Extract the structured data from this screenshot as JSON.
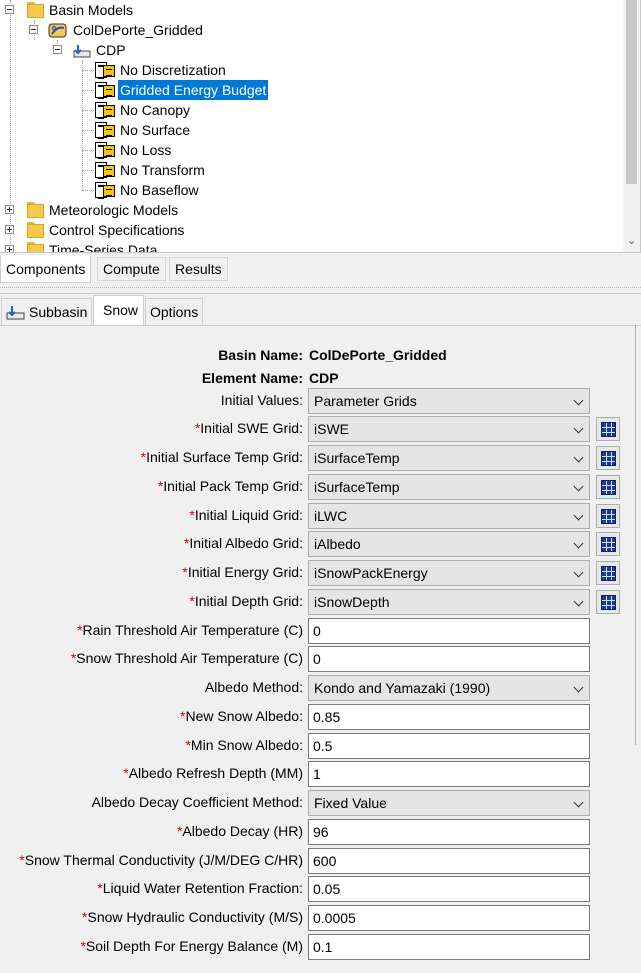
{
  "tree": {
    "basin_models": "Basin Models",
    "basin": "ColDePorte_Gridded",
    "cdp": "CDP",
    "methods": [
      "No Discretization",
      "Gridded Energy Budget",
      "No Canopy",
      "No Surface",
      "No Loss",
      "No Transform",
      "No Baseflow"
    ],
    "selected_method": "Gridded Energy Budget",
    "meteorologic_models": "Meteorologic Models",
    "control_specifications": "Control Specifications",
    "time_series_data": "Time-Series Data"
  },
  "bottom_tabs": [
    "Components",
    "Compute",
    "Results"
  ],
  "editor_tabs": {
    "subbasin": "Subbasin",
    "snow": "Snow",
    "options": "Options"
  },
  "form": {
    "basin_name_label": "Basin Name:",
    "basin_name_value": "ColDePorte_Gridded",
    "element_name_label": "Element Name:",
    "element_name_value": "CDP",
    "initial_values_label": "Initial Values:",
    "initial_values_value": "Parameter Grids",
    "required_marker": "*",
    "initial_swe_label": "Initial SWE Grid:",
    "initial_swe_value": "iSWE",
    "initial_surface_temp_label": "Initial Surface Temp Grid:",
    "initial_surface_temp_value": "iSurfaceTemp",
    "initial_pack_temp_label": "Initial Pack Temp Grid:",
    "initial_pack_temp_value": "iSurfaceTemp",
    "initial_liquid_label": "Initial Liquid Grid:",
    "initial_liquid_value": "iLWC",
    "initial_albedo_label": "Initial Albedo Grid:",
    "initial_albedo_value": "iAlbedo",
    "initial_energy_label": "Initial Energy Grid:",
    "initial_energy_value": "iSnowPackEnergy",
    "initial_depth_label": "Initial Depth Grid:",
    "initial_depth_value": "iSnowDepth",
    "rain_threshold_label": "Rain Threshold Air Temperature (C)",
    "rain_threshold_value": "0",
    "snow_threshold_label": "Snow Threshold Air Temperature (C)",
    "snow_threshold_value": "0",
    "albedo_method_label": "Albedo Method:",
    "albedo_method_value": "Kondo and Yamazaki (1990)",
    "new_snow_albedo_label": "New Snow Albedo:",
    "new_snow_albedo_value": "0.85",
    "min_snow_albedo_label": "Min Snow Albedo:",
    "min_snow_albedo_value": "0.5",
    "albedo_refresh_label": "Albedo Refresh Depth (MM)",
    "albedo_refresh_value": "1",
    "albedo_decay_method_label": "Albedo Decay Coefficient Method:",
    "albedo_decay_method_value": "Fixed Value",
    "albedo_decay_label": "Albedo Decay (HR)",
    "albedo_decay_value": "96",
    "snow_thermal_label": "Snow Thermal Conductivity (J/M/DEG C/HR)",
    "snow_thermal_value": "600",
    "liquid_retention_label": "Liquid Water Retention Fraction:",
    "liquid_retention_value": "0.05",
    "snow_hydraulic_label": "Snow Hydraulic Conductivity (M/S)",
    "snow_hydraulic_value": "0.0005",
    "soil_depth_label": "Soil Depth For Energy Balance (M)",
    "soil_depth_value": "0.1"
  },
  "icons": {
    "folder": "folder-icon",
    "method": "method-icon",
    "basin_model": "basin-model-icon",
    "subbasin": "subbasin-icon",
    "grid": "grid-icon"
  }
}
